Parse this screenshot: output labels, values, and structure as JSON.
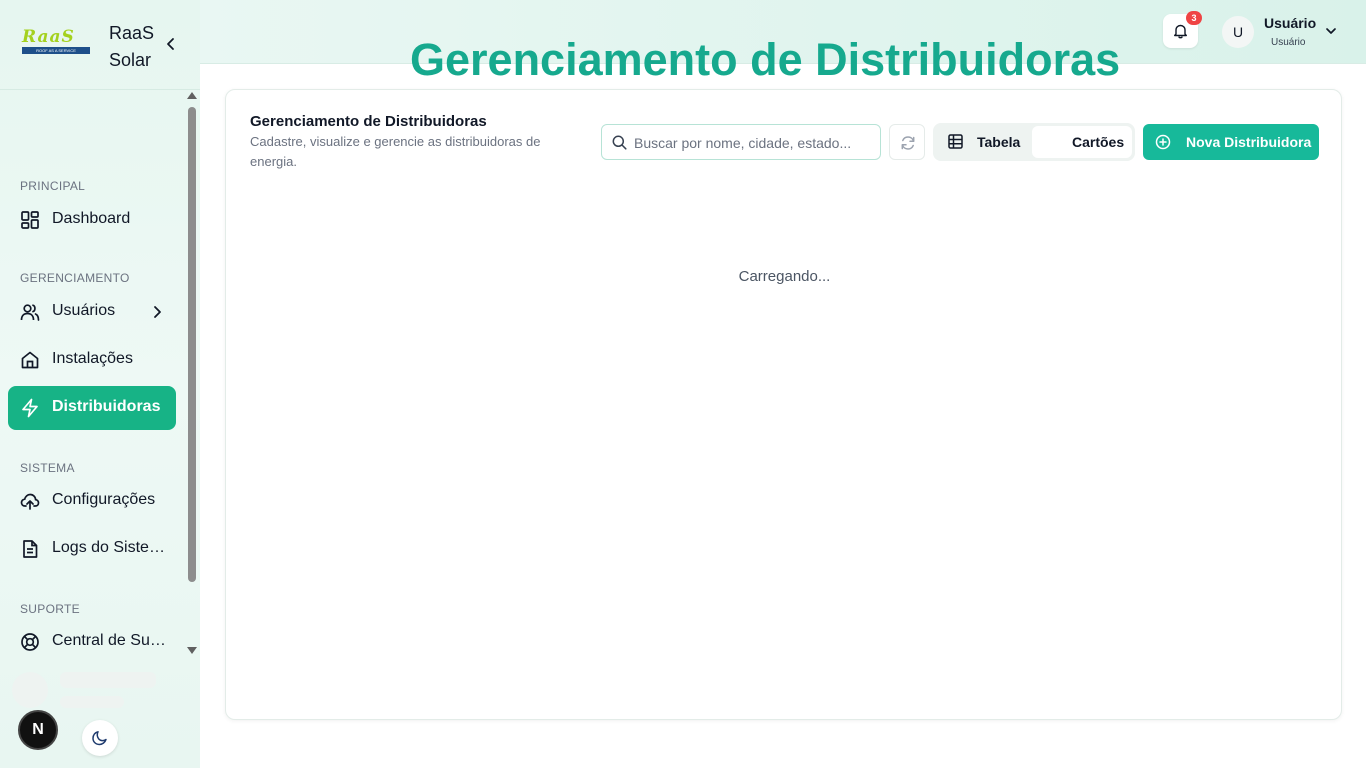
{
  "sidebar": {
    "logo_text": "RaaS",
    "logo_tagline": "ROOF AS A SERVICE",
    "brand_name": "RaaS Solar",
    "sections": {
      "principal": "PRINCIPAL",
      "gerenciamento": "GERENCIAMENTO",
      "sistema": "SISTEMA",
      "suporte": "SUPORTE"
    },
    "items": {
      "dashboard": "Dashboard",
      "usuarios": "Usuários",
      "instalacoes": "Instalações",
      "distribuidoras": "Distribuidoras",
      "configuracoes": "Configurações",
      "logs": "Logs do Sistema",
      "central": "Central de Suporte"
    },
    "active_item": "distribuidoras",
    "next_badge": "N"
  },
  "header": {
    "page_title": "Gerenciamento de Distribuidoras",
    "notifications_count": "3",
    "avatar_initial": "U",
    "user_name": "Usuário",
    "user_role": "Usuário"
  },
  "main": {
    "title": "Gerenciamento de Distribuidoras",
    "subtitle": "Cadastre, visualize e gerencie as distribuidoras de energia.",
    "search_placeholder": "Buscar por nome, cidade, estado...",
    "view_table_label": "Tabela",
    "view_cards_label": "Cartões",
    "new_button_label": "Nova Distribuidora",
    "loading_text": "Carregando..."
  },
  "colors": {
    "accent": "#17b386",
    "title": "#16a98e",
    "badge": "#ef4444"
  }
}
